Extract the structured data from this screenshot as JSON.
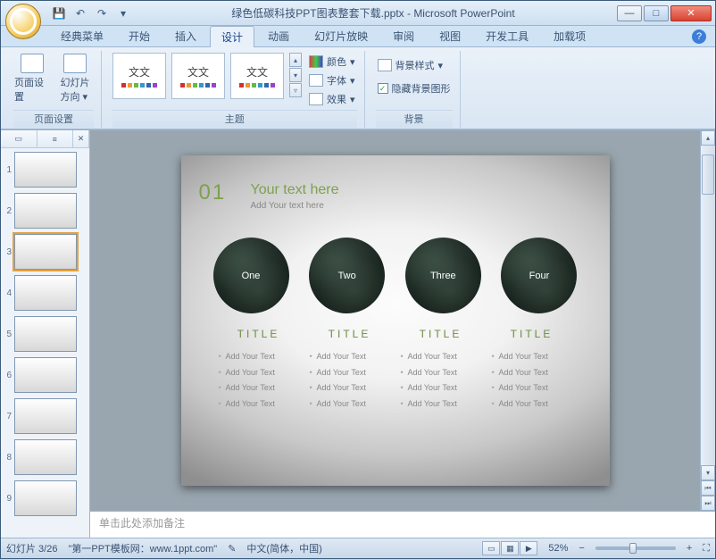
{
  "window": {
    "title": "绿色低碳科技PPT图表整套下载.pptx - Microsoft PowerPoint",
    "min": "—",
    "max": "□",
    "close": "✕"
  },
  "qat": {
    "save": "💾",
    "undo": "↶",
    "redo": "↷",
    "more": "▾"
  },
  "tabs": {
    "items": [
      "经典菜单",
      "开始",
      "插入",
      "设计",
      "动画",
      "幻灯片放映",
      "审阅",
      "视图",
      "开发工具",
      "加载项"
    ],
    "active_index": 3
  },
  "ribbon": {
    "page_setup": {
      "btn1": "页面设置",
      "btn2_l1": "幻灯片",
      "btn2_l2": "方向",
      "group": "页面设置"
    },
    "themes": {
      "label": "主题",
      "thumb_text": "文文",
      "colors": "颜色",
      "fonts": "字体",
      "effects": "效果"
    },
    "background": {
      "label": "背景",
      "style": "背景样式",
      "hide": "隐藏背景图形"
    }
  },
  "thumbs": {
    "tab1": "▭",
    "tab2": "≡",
    "close": "✕",
    "count": 9,
    "selected": 3
  },
  "slide": {
    "num": "01",
    "title": "Your text here",
    "subtitle": "Add Your text here",
    "circles": [
      "One",
      "Two",
      "Three",
      "Four"
    ],
    "col_title": "TITLE",
    "col_item": "Add Your Text"
  },
  "notes": {
    "placeholder": "单击此处添加备注"
  },
  "status": {
    "slide": "幻灯片 3/26",
    "source": "\"第一PPT模板网：www.1ppt.com\"",
    "lang": "中文(简体，中国)",
    "zoom": "52%"
  }
}
